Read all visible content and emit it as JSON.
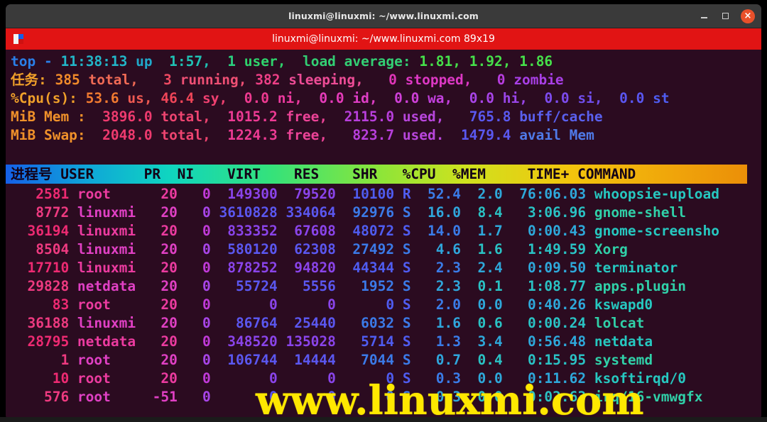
{
  "window": {
    "title": "linuxmi@linuxmi: ~/www.linuxmi.com",
    "controls": {
      "minimize": "minimize",
      "maximize": "maximize",
      "close": "×"
    }
  },
  "tab": {
    "label": "linuxmi@linuxmi: ~/www.linuxmi.com 89x19",
    "icon": "terminator-icon",
    "background": "#e11414"
  },
  "watermark": {
    "text": "www.linuxmi.com",
    "color": "#ffe800"
  },
  "terminal": {
    "background": "#2b0b20",
    "summary": {
      "uptime_line": {
        "segments": [
          {
            "t": "top",
            "c": "#2a7fe8"
          },
          {
            "t": " - ",
            "c": "#2a7fe8"
          },
          {
            "t": "11:38:13",
            "c": "#22b6c8"
          },
          {
            "t": " up ",
            "c": "#20a8c9"
          },
          {
            "t": " 1:57,",
            "c": "#1fc2b4"
          },
          {
            "t": "  1 ",
            "c": "#2ad07f"
          },
          {
            "t": "user,",
            "c": "#2fd36c"
          },
          {
            "t": "  load average: ",
            "c": "#33cf74"
          },
          {
            "t": "1.81, 1.92, 1.86",
            "c": "#46e04a"
          }
        ]
      },
      "tasks_line": {
        "segments": [
          {
            "t": "任务: ",
            "c": "#f0a02a"
          },
          {
            "t": "385",
            "c": "#f08a2a"
          },
          {
            "t": " total,",
            "c": "#f06a55"
          },
          {
            "t": "   3 ",
            "c": "#ef4a62"
          },
          {
            "t": "running,",
            "c": "#ef4f74"
          },
          {
            "t": " 382 ",
            "c": "#ee3f86"
          },
          {
            "t": "sleeping,",
            "c": "#ed4c96"
          },
          {
            "t": "   0 ",
            "c": "#e035b8"
          },
          {
            "t": "stopped,",
            "c": "#dd38c4"
          },
          {
            "t": "   0 ",
            "c": "#b83de0"
          },
          {
            "t": "zombie",
            "c": "#a83fe6"
          }
        ]
      },
      "cpu_line": {
        "segments": [
          {
            "t": "%Cpu(s): ",
            "c": "#f0a02a"
          },
          {
            "t": "53.6",
            "c": "#f07a30"
          },
          {
            "t": " us,",
            "c": "#f05a52"
          },
          {
            "t": " 46.4",
            "c": "#ef4558"
          },
          {
            "t": " sy,",
            "c": "#ef4070"
          },
          {
            "t": "  0.0",
            "c": "#ee3a90"
          },
          {
            "t": " ni,",
            "c": "#ee3aa0"
          },
          {
            "t": "  0.0",
            "c": "#e63bba"
          },
          {
            "t": " id,",
            "c": "#df3ec6"
          },
          {
            "t": "  0.0",
            "c": "#cf40d8"
          },
          {
            "t": " wa,",
            "c": "#c340de"
          },
          {
            "t": "  0.0",
            "c": "#a844e8"
          },
          {
            "t": " hi,",
            "c": "#9a46ea"
          },
          {
            "t": "  0.0",
            "c": "#7d4bee"
          },
          {
            "t": " si,",
            "c": "#704eee"
          },
          {
            "t": "  0.0",
            "c": "#5a56f0"
          },
          {
            "t": " st",
            "c": "#4f5cf0"
          }
        ]
      },
      "mem_line": {
        "segments": [
          {
            "t": "MiB Mem : ",
            "c": "#f0912a"
          },
          {
            "t": " 3896.0",
            "c": "#ee3a6e"
          },
          {
            "t": " total,",
            "c": "#ee4470"
          },
          {
            "t": "  1015.2",
            "c": "#ed3a93"
          },
          {
            "t": " free,",
            "c": "#ec4397"
          },
          {
            "t": "  2115.0",
            "c": "#b83fdc"
          },
          {
            "t": " used,",
            "c": "#b846dc"
          },
          {
            "t": "   765.8",
            "c": "#5a58ef"
          },
          {
            "t": " buff/cache",
            "c": "#5a60ee"
          }
        ]
      },
      "swap_line": {
        "segments": [
          {
            "t": "MiB Swap: ",
            "c": "#f0912a"
          },
          {
            "t": " 2048.0",
            "c": "#ee3a6e"
          },
          {
            "t": " total,",
            "c": "#ee4470"
          },
          {
            "t": "  1224.3",
            "c": "#ed3a93"
          },
          {
            "t": " free,",
            "c": "#ec4397"
          },
          {
            "t": "   823.7",
            "c": "#b83fdc"
          },
          {
            "t": " used.",
            "c": "#b846dc"
          },
          {
            "t": "  1479.4",
            "c": "#5a58ef"
          },
          {
            "t": " avail Mem",
            "c": "#4f7ae8"
          }
        ]
      }
    },
    "columns": [
      "进程号",
      "USER",
      "PR",
      "NI",
      "VIRT",
      "RES",
      "SHR",
      "%CPU",
      "%MEM",
      "TIME+",
      "COMMAND"
    ],
    "header_text": "进程号 USER      PR  NI    VIRT    RES    SHR   %CPU  %MEM     TIME+ COMMAND",
    "rows": [
      {
        "pid": "2581",
        "user": "root",
        "pr": "20",
        "ni": "0",
        "virt": "149300",
        "res": "79520",
        "shr": "10100",
        "s": "R",
        "cpu": "52.4",
        "mem": "2.0",
        "time": "76:06.03",
        "command": "whoopsie-upload"
      },
      {
        "pid": "8772",
        "user": "linuxmi",
        "pr": "20",
        "ni": "0",
        "virt": "3610828",
        "res": "334064",
        "shr": "92976",
        "s": "S",
        "cpu": "16.0",
        "mem": "8.4",
        "time": "3:06.96",
        "command": "gnome-shell"
      },
      {
        "pid": "36194",
        "user": "linuxmi",
        "pr": "20",
        "ni": "0",
        "virt": "833352",
        "res": "67608",
        "shr": "48072",
        "s": "S",
        "cpu": "14.0",
        "mem": "1.7",
        "time": "0:00.43",
        "command": "gnome-screensho"
      },
      {
        "pid": "8504",
        "user": "linuxmi",
        "pr": "20",
        "ni": "0",
        "virt": "580120",
        "res": "62308",
        "shr": "27492",
        "s": "S",
        "cpu": "4.6",
        "mem": "1.6",
        "time": "1:49.59",
        "command": "Xorg"
      },
      {
        "pid": "17710",
        "user": "linuxmi",
        "pr": "20",
        "ni": "0",
        "virt": "878252",
        "res": "94820",
        "shr": "44344",
        "s": "S",
        "cpu": "2.3",
        "mem": "2.4",
        "time": "0:09.50",
        "command": "terminator"
      },
      {
        "pid": "29828",
        "user": "netdata",
        "pr": "20",
        "ni": "0",
        "virt": "55724",
        "res": "5556",
        "shr": "1952",
        "s": "S",
        "cpu": "2.3",
        "mem": "0.1",
        "time": "1:08.77",
        "command": "apps.plugin"
      },
      {
        "pid": "83",
        "user": "root",
        "pr": "20",
        "ni": "0",
        "virt": "0",
        "res": "0",
        "shr": "0",
        "s": "S",
        "cpu": "2.0",
        "mem": "0.0",
        "time": "0:40.26",
        "command": "kswapd0"
      },
      {
        "pid": "36188",
        "user": "linuxmi",
        "pr": "20",
        "ni": "0",
        "virt": "86764",
        "res": "25440",
        "shr": "6032",
        "s": "S",
        "cpu": "1.6",
        "mem": "0.6",
        "time": "0:00.24",
        "command": "lolcat"
      },
      {
        "pid": "28795",
        "user": "netdata",
        "pr": "20",
        "ni": "0",
        "virt": "348520",
        "res": "135028",
        "shr": "5714",
        "s": "S",
        "cpu": "1.3",
        "mem": "3.4",
        "time": "0:56.48",
        "command": "netdata"
      },
      {
        "pid": "1",
        "user": "root",
        "pr": "20",
        "ni": "0",
        "virt": "106744",
        "res": "14444",
        "shr": "7044",
        "s": "S",
        "cpu": "0.7",
        "mem": "0.4",
        "time": "0:15.95",
        "command": "systemd"
      },
      {
        "pid": "10",
        "user": "root",
        "pr": "20",
        "ni": "0",
        "virt": "0",
        "res": "0",
        "shr": "0",
        "s": "S",
        "cpu": "0.3",
        "mem": "0.0",
        "time": "0:11.62",
        "command": "ksoftirqd/0"
      },
      {
        "pid": "576",
        "user": "root",
        "pr": "-51",
        "ni": "0",
        "virt": "0",
        "res": "0",
        "shr": "0",
        "s": "S",
        "cpu": "0.3",
        "mem": "0.0",
        "time": "0:02.63",
        "command": "irq/16-vmwgfx"
      }
    ],
    "row_palette": [
      [
        "#ee2a72",
        "#ec3ba0",
        "#c03ad8",
        "#8a44ea",
        "#4f5cf0",
        "#3a7ce8",
        "#2ea8da",
        "#26c8c0"
      ],
      [
        "#ee3a80",
        "#e040c4",
        "#a845e8",
        "#5b57f0",
        "#3b7ae8",
        "#2fa6dc",
        "#2ac2c4",
        "#30d0a8"
      ]
    ]
  }
}
